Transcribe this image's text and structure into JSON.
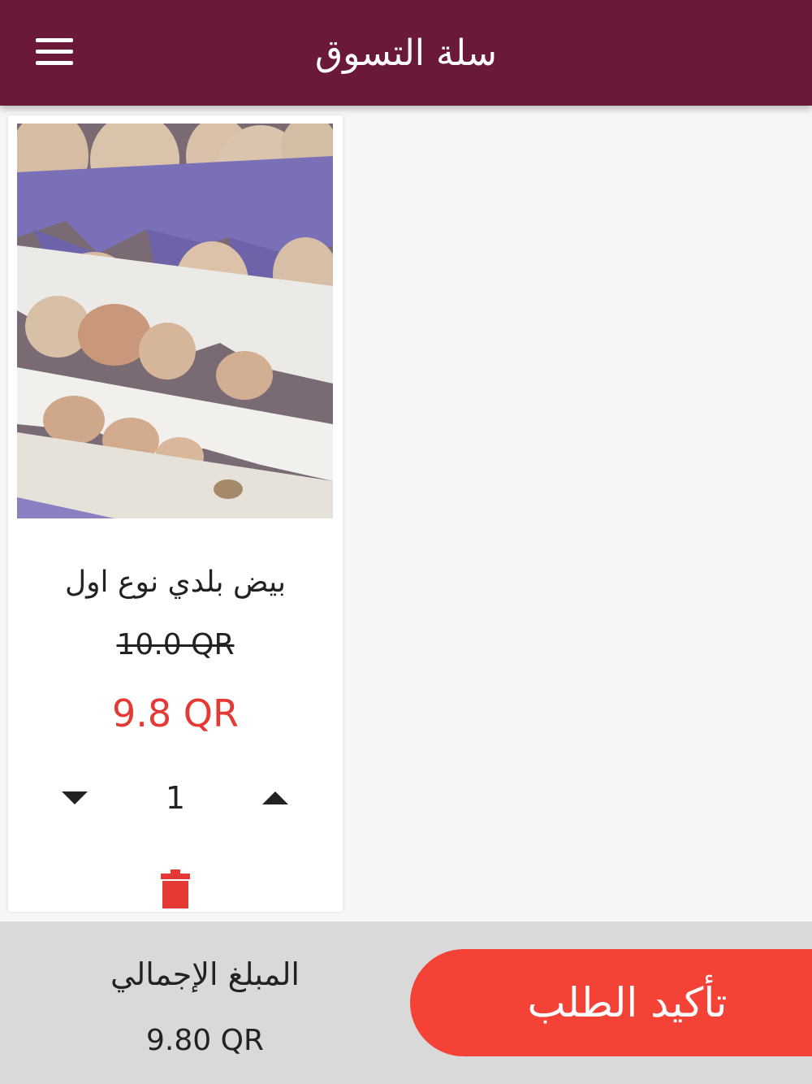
{
  "header": {
    "title": "سلة التسوق",
    "menu_icon": "hamburger-menu-icon",
    "background_color": "#6a1938"
  },
  "cart": {
    "items": [
      {
        "name": "بيض بلدي نوع اول",
        "old_price": "10.0 QR",
        "price": "9.8 QR",
        "quantity": "1",
        "image": "egg-trays-photo",
        "decrease_icon": "triangle-down-icon",
        "increase_icon": "triangle-up-icon",
        "delete_icon": "trash-icon"
      }
    ]
  },
  "footer": {
    "total_label": "المبلغ الإجمالي",
    "total_value": "9.80 QR",
    "confirm_label": "تأكيد الطلب",
    "accent_color": "#f44336"
  }
}
